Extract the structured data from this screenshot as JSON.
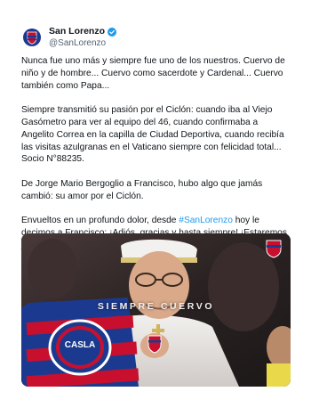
{
  "account": {
    "display_name": "San Lorenzo",
    "handle": "@SanLorenzo",
    "avatar_icon": "san-lorenzo-crest-icon",
    "verified_icon": "verified-badge-icon"
  },
  "post": {
    "paragraphs": [
      "Nunca fue uno más y siempre fue uno de los nuestros. Cuervo de niño y de hombre... Cuervo como sacerdote y Cardenal... Cuervo también como Papa...",
      "Siempre transmitió su pasión por el Ciclón: cuando iba al Viejo Gasómetro para ver al equipo del 46, cuando confirmaba a Angelito Correa en la capilla de Ciudad Deportiva, cuando recibía las visitas azulgranas en el Vaticano siempre con felicidad total... Socio N°88235.",
      "De Jorge Mario Bergoglio a Francisco, hubo algo que jamás cambió: su amor por el Ciclón."
    ],
    "last_paragraph": {
      "before": "Envueltos en un profundo dolor, desde ",
      "hashtag": "#SanLorenzo",
      "after": " hoy le decimos a Francisco: ¡Adiós, gracias y hasta siempre! ¡Estaremos juntos por la eternidad!"
    }
  },
  "media": {
    "overlay_text": "SIEMPRE CUERVO",
    "crest_letters": "CASLA"
  },
  "colors": {
    "text": "#0f1419",
    "secondary": "#536471",
    "link": "#1d9bf0",
    "club_blue": "#1b3a8f",
    "club_red": "#c8102e"
  }
}
